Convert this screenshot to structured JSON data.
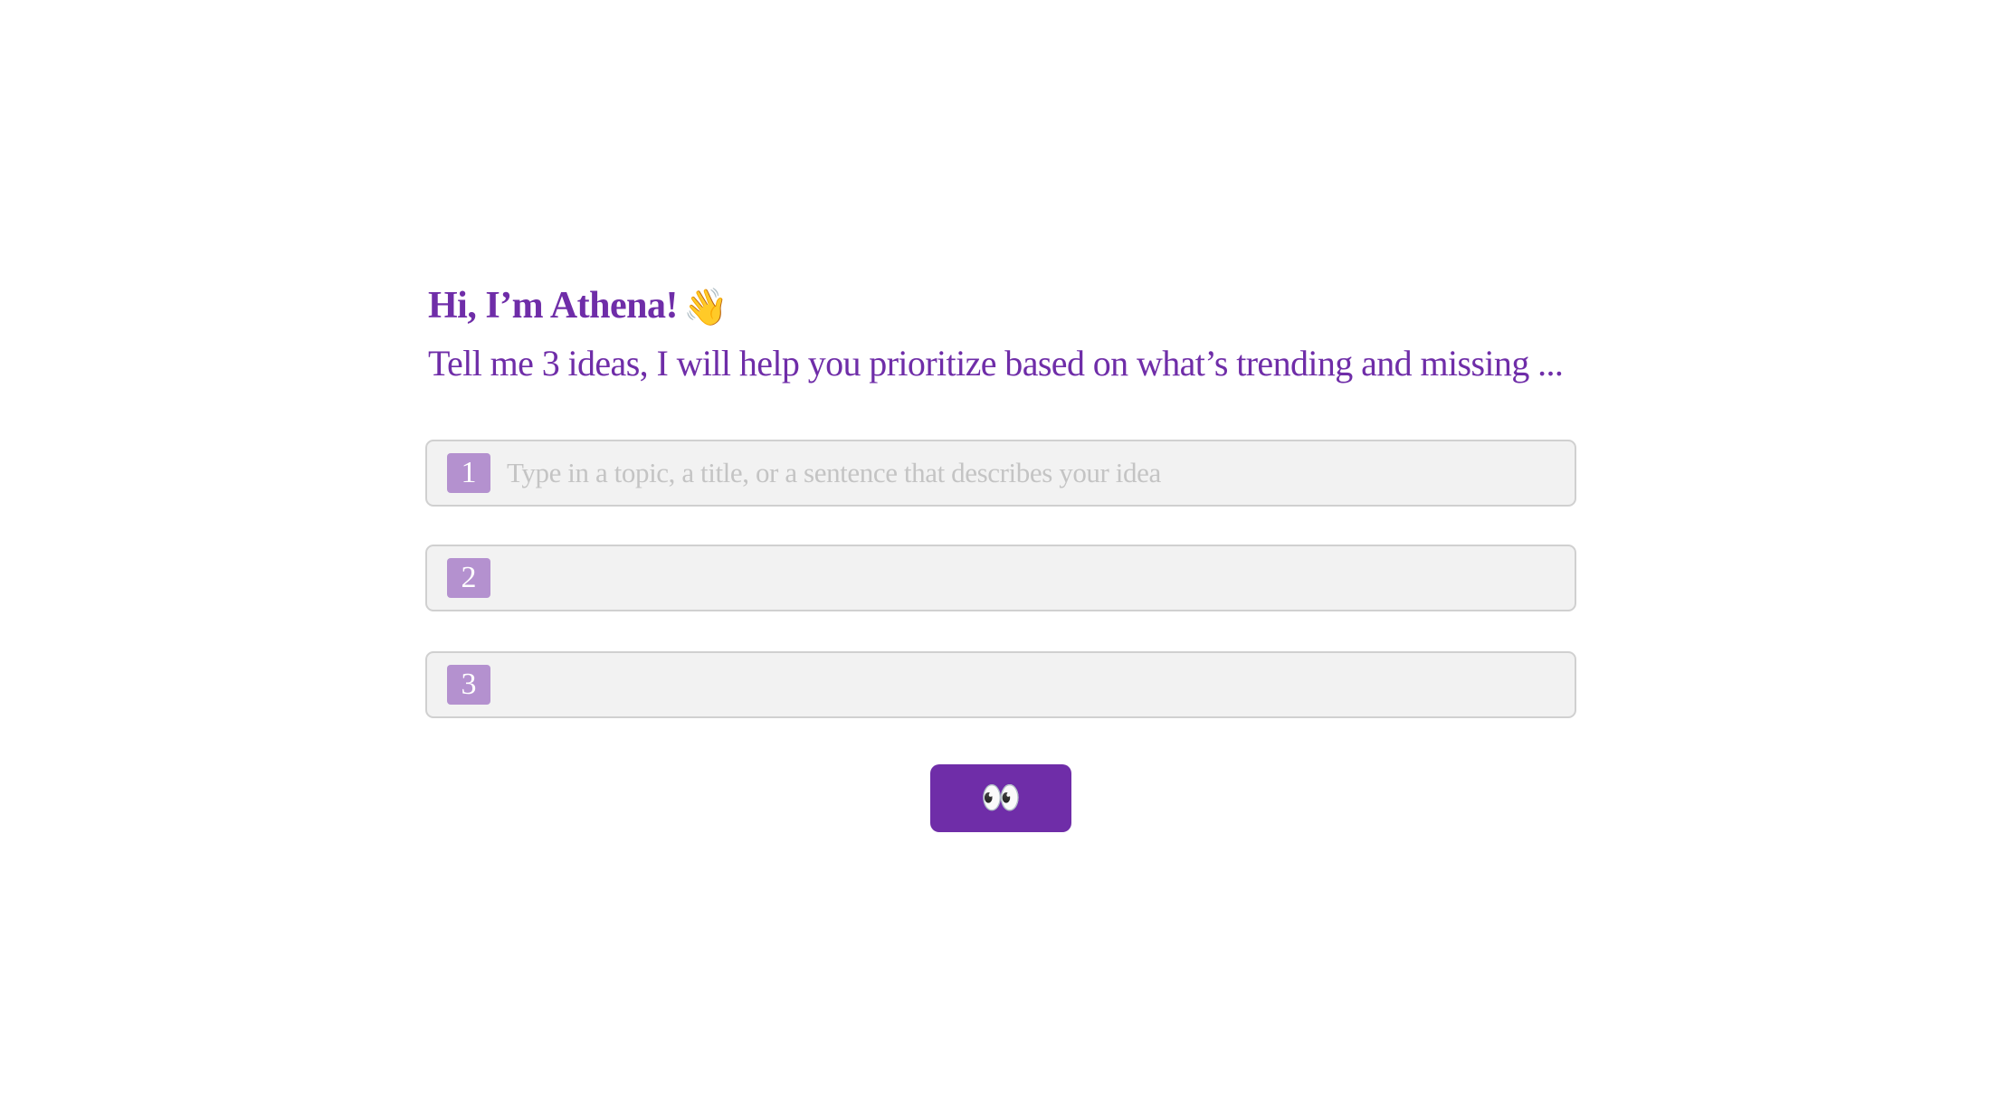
{
  "header": {
    "greeting": "Hi, I’m Athena!",
    "greeting_emoji": "👋",
    "subtitle": "Tell me 3 ideas, I will help you prioritize based on what’s trending and missing ..."
  },
  "ideas": [
    {
      "number": "1",
      "value": "",
      "placeholder": "Type in a topic, a title, or a sentence that describes your idea"
    },
    {
      "number": "2",
      "value": "",
      "placeholder": ""
    },
    {
      "number": "3",
      "value": "",
      "placeholder": ""
    }
  ],
  "submit": {
    "label": "👀",
    "icon": "eyes-icon"
  },
  "colors": {
    "accent": "#6f2da8",
    "badge": "#b491cf",
    "field_background": "#f2f2f2",
    "field_border": "#d0d0d0",
    "placeholder": "#c4c4c4"
  }
}
